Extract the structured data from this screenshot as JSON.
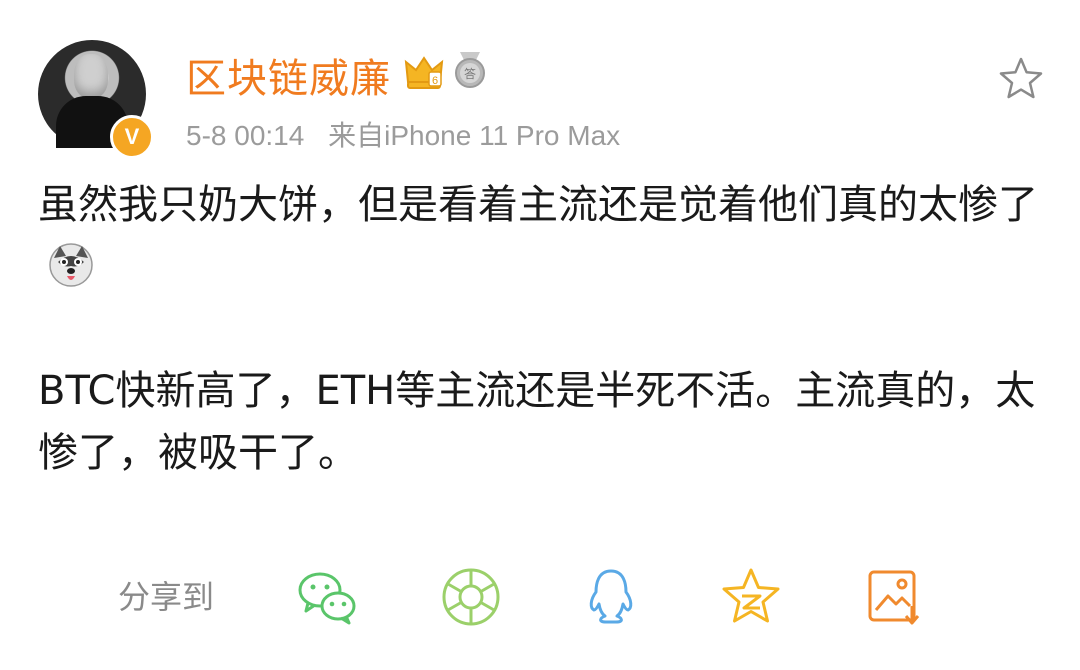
{
  "post": {
    "username": "区块链威廉",
    "time": "5-8 00:14",
    "source": "来自iPhone 11 Pro Max",
    "paragraphs": [
      "虽然我只奶大饼，但是看着主流还是觉着他们真的太惨了",
      "BTC快新高了，ETH等主流还是半死不活。主流真的，太惨了，被吸干了。"
    ],
    "emoji": "husky-emoji"
  },
  "badges": {
    "verified": "V",
    "crown_icon": "crown-icon",
    "medal_icon": "medal-icon",
    "medal_label": "答"
  },
  "share": {
    "label": "分享到",
    "icons": [
      "wechat-icon",
      "moments-icon",
      "qq-icon",
      "qzone-icon",
      "screenshot-icon"
    ]
  },
  "colors": {
    "username": "#f07b1f",
    "meta": "#9b9b9b",
    "wechat": "#5ac56a",
    "moments": "#9bd06a",
    "qq": "#5aa9e6",
    "qzone": "#f5b523",
    "screenshot": "#f08a2e"
  }
}
